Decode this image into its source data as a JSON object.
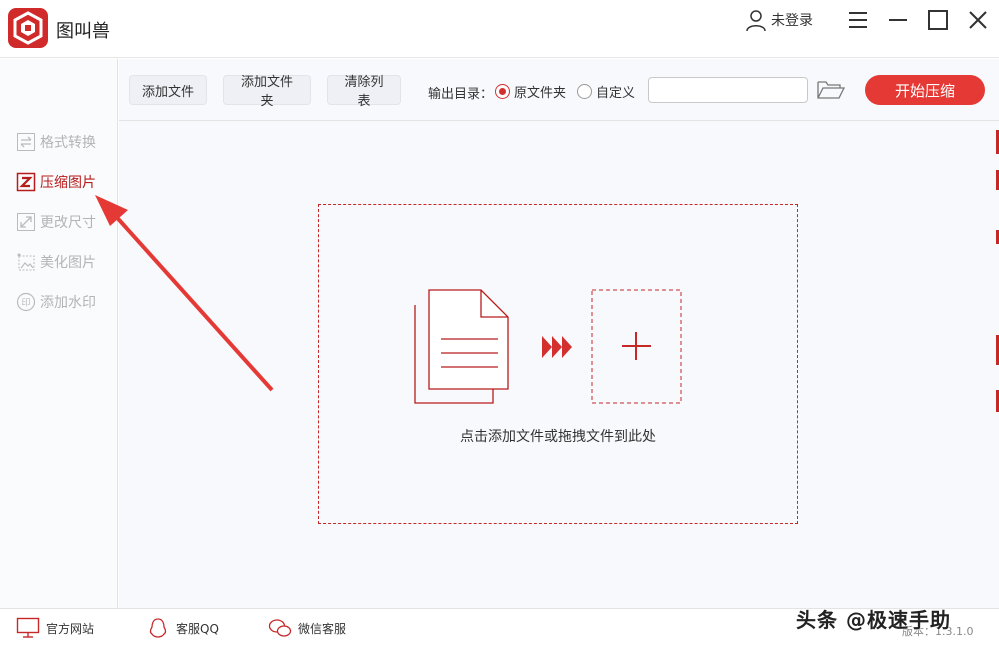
{
  "app": {
    "title": "图叫兽",
    "login_label": "未登录"
  },
  "sidebar": {
    "items": [
      {
        "label": "格式转换",
        "icon": "convert-icon"
      },
      {
        "label": "压缩图片",
        "icon": "compress-icon",
        "active": true
      },
      {
        "label": "更改尺寸",
        "icon": "resize-icon"
      },
      {
        "label": "美化图片",
        "icon": "beautify-icon"
      },
      {
        "label": "添加水印",
        "icon": "watermark-icon"
      }
    ]
  },
  "toolbar": {
    "add_file": "添加文件",
    "add_folder": "添加文件夹",
    "clear_list": "清除列表",
    "output_label": "输出目录：",
    "radio_original": "原文件夹",
    "radio_custom": "自定义",
    "selected_output": "原文件夹",
    "path_value": "",
    "start_button": "开始压缩"
  },
  "dropzone": {
    "hint": "点击添加文件或拖拽文件到此处"
  },
  "footer": {
    "website": "官方网站",
    "qq_service": "客服QQ",
    "wechat_service": "微信客服",
    "version": "版本：1.3.1.0"
  },
  "watermark": "头条 @极速手助",
  "colors": {
    "accent": "#e53935",
    "accent_dark": "#b71c1c",
    "sidebar_bg": "#fafbfd",
    "main_bg": "#f8f9fd"
  }
}
